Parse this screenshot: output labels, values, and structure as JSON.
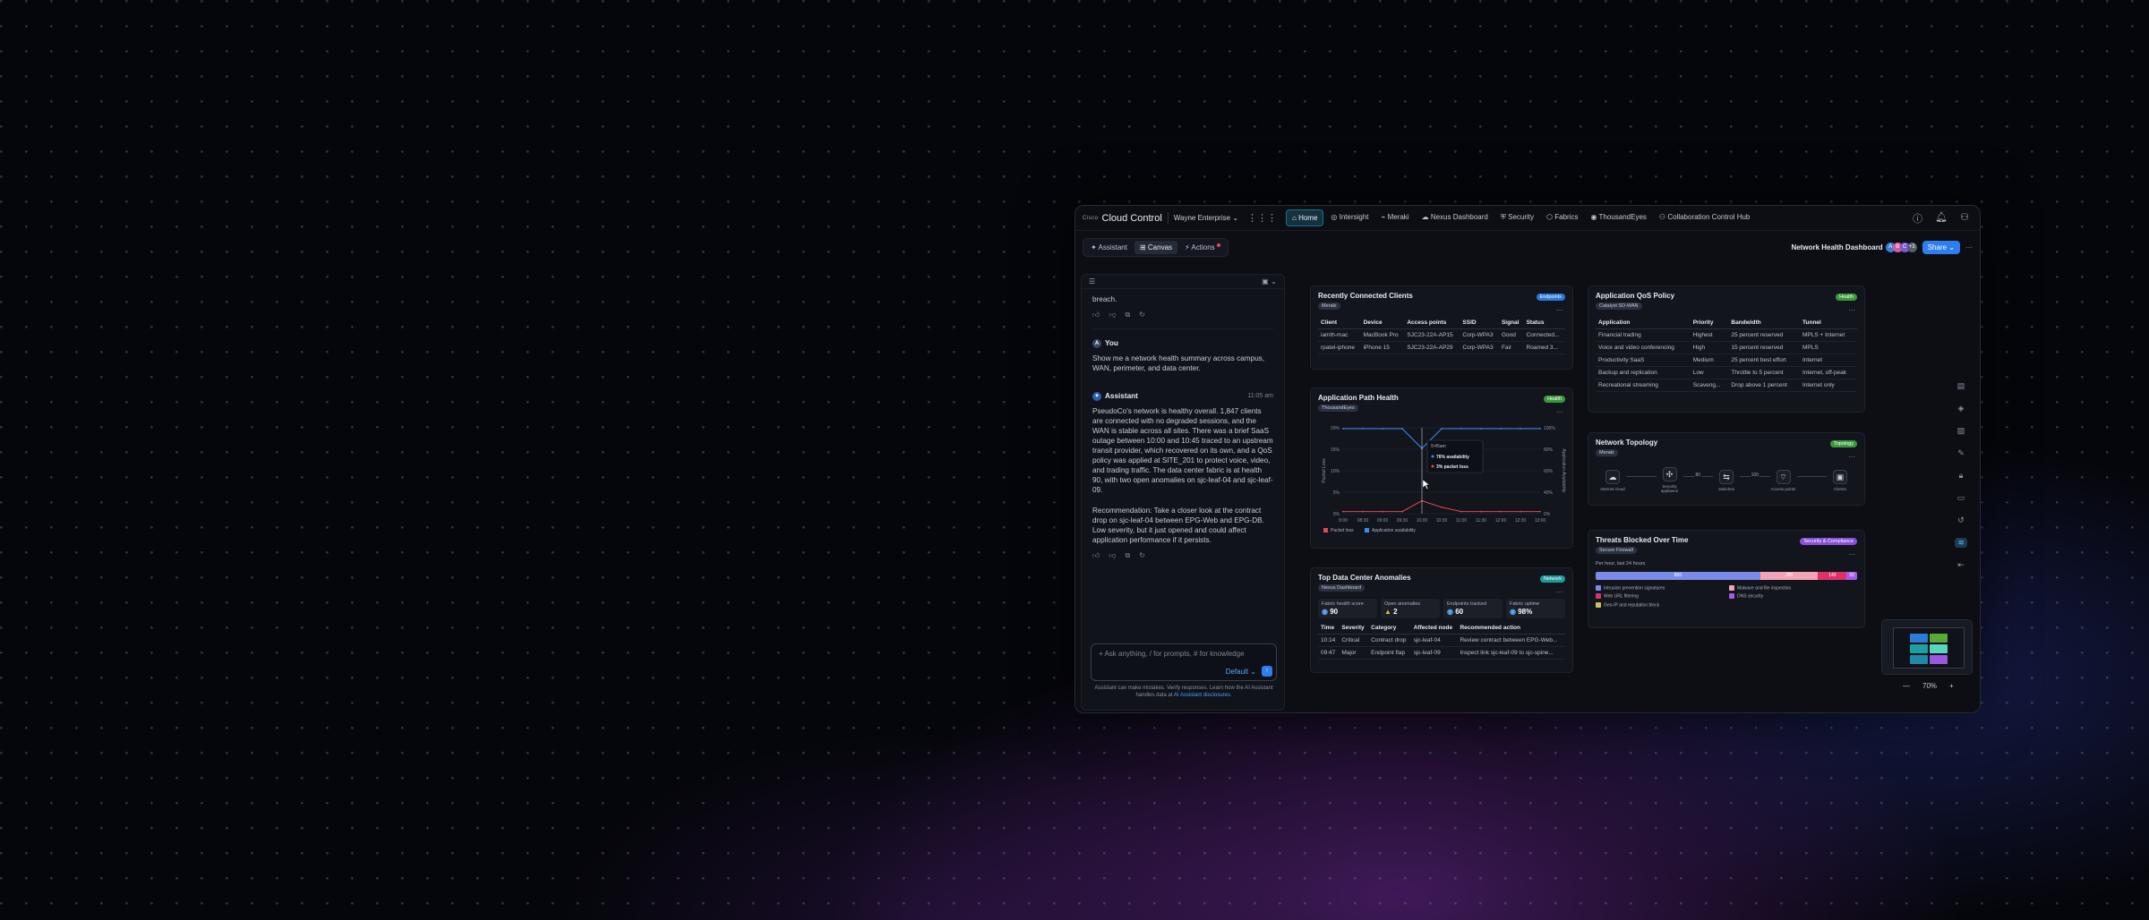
{
  "app": {
    "brand": "Cisco",
    "title": "Cloud Control",
    "org": "Wayne Enterprise"
  },
  "nav": {
    "tabs": [
      "Home",
      "Intersight",
      "Meraki",
      "Nexus Dashboard",
      "Security",
      "Fabrics",
      "ThousandEyes",
      "Collaboration Control Hub"
    ],
    "active": "Home"
  },
  "modes": {
    "assistant": "Assistant",
    "canvas": "Canvas",
    "actions": "Actions"
  },
  "dashboard": {
    "title": "Network Health Dashboard",
    "avatars": [
      "A",
      "B",
      "C",
      "+3"
    ],
    "share": "Share"
  },
  "chat": {
    "prev_tail": "breach.",
    "user_name": "You",
    "user_msg": "Show me a network health summary across campus, WAN, perimeter, and data center.",
    "assistant_name": "Assistant",
    "time": "11:05 am",
    "reply1": "PseudoCo's network is healthy overall. 1,847 clients are connected with no degraded sessions, and the WAN is stable across all sites. There was a brief SaaS outage between 10:00 and 10:45 traced to an upstream transit provider, which recovered on its own, and a QoS policy was applied at SITE_201 to protect voice, video, and trading traffic. The data center fabric is at health 90, with two open anomalies on sjc-leaf-04 and sjc-leaf-09.",
    "reply2": "Recommendation: Take a closer look at the contract drop on sjc-leaf-04 between EPG-Web and EPG-DB. Low severity, but it just opened and could affect application performance if it persists.",
    "placeholder": "Ask anything, / for prompts, # for knowledge",
    "model": "Default",
    "disclaimer": "Assistant can make mistakes. Verify responses. Learn how the AI Assistant handles data at",
    "disclaimer_link": "AI Assistant disclosures."
  },
  "clients": {
    "title": "Recently Connected Clients",
    "source": "Meraki",
    "tag": "Endpoints",
    "tag_color": "#2a79d8",
    "headers": [
      "Client",
      "Device",
      "Access points",
      "SSID",
      "Signal",
      "Status"
    ],
    "rows": [
      [
        "iamth-mac",
        "MacBook Pro",
        "SJC23-22A-AP15",
        "Corp-WPA3",
        "Good",
        "Connected..."
      ],
      [
        "rpatel-iphone",
        "iPhone 15",
        "SJC23-22A-AP29",
        "Corp-WPA3",
        "Fair",
        "Roamed 3..."
      ]
    ]
  },
  "qos": {
    "title": "Application QoS Policy",
    "source": "Catalyst SD-WAN",
    "tag": "Health",
    "tag_color": "#3a9a3a",
    "headers": [
      "Application",
      "Priority",
      "Bandwidth",
      "Tunnel"
    ],
    "rows": [
      [
        "Financial trading",
        "Highest",
        "25 percent reserved",
        "MPLS + Internet"
      ],
      [
        "Voice and video conferencing",
        "High",
        "15 percent reserved",
        "MPLS"
      ],
      [
        "Productivity SaaS",
        "Medium",
        "25 percent best effort",
        "Internet"
      ],
      [
        "Backup and replication",
        "Low",
        "Throttle to 5 percent",
        "Internet, off-peak"
      ],
      [
        "Recreational streaming",
        "Scaveng...",
        "Drop above 1 percent",
        "Internet only"
      ]
    ]
  },
  "path": {
    "title": "Application Path Health",
    "source": "ThousandEyes",
    "tag": "Health",
    "tag_color": "#3a9a3a",
    "left_axis": "Packet Loss",
    "right_axis": "Application Availability",
    "left_ticks": [
      "20%",
      "15%",
      "10%",
      "5%",
      "0%"
    ],
    "right_ticks": [
      "100%",
      "80%",
      "60%",
      "40%",
      "0%"
    ],
    "x_ticks": [
      "8:00",
      "08:30",
      "09:00",
      "09:30",
      "10:00",
      "10:30",
      "11:00",
      "11:30",
      "12:00",
      "12:30",
      "13:00"
    ],
    "tooltip_time": "9:45am",
    "tooltip_avail": "76% availability",
    "tooltip_loss": "3% packet loss",
    "legend": [
      "Packet loss",
      "Application availability"
    ],
    "loss_color": "#e5484d",
    "avail_color": "#3d8bf0"
  },
  "chart_data": {
    "type": "line",
    "x": [
      "8:00",
      "08:30",
      "09:00",
      "09:30",
      "10:00",
      "10:30",
      "11:00",
      "11:30",
      "12:00",
      "12:30",
      "13:00"
    ],
    "series": [
      {
        "name": "Packet loss",
        "values": [
          0.5,
          0.5,
          0.5,
          0.5,
          3,
          1.5,
          0.5,
          0.5,
          0.5,
          0.5,
          0.5
        ]
      },
      {
        "name": "Application availability",
        "values": [
          99,
          99,
          99,
          99,
          76,
          99,
          99,
          99,
          99,
          99,
          99
        ]
      }
    ],
    "ylim_left": [
      0,
      20
    ],
    "ylim_right": [
      0,
      100
    ]
  },
  "topology": {
    "title": "Network Topology",
    "source": "Meraki",
    "tag": "Topology",
    "tag_color": "#3a9a3a",
    "nodes": [
      "Internet cloud",
      "Security appliance",
      "Switches",
      "Access points",
      "Clients"
    ],
    "links": [
      "",
      "80",
      "100",
      "",
      ""
    ]
  },
  "threats": {
    "title": "Threats Blocked Over Time",
    "source": "Secure Firewall",
    "tag": "Security & Compliance",
    "tag_color": "#8a4fd8",
    "range": "Per hour, last 24 hours",
    "segments": [
      {
        "label": "800",
        "value": 800,
        "color": "#7b8be8"
      },
      {
        "label": "280",
        "value": 280,
        "color": "#f3a3b4"
      },
      {
        "label": "140",
        "value": 140,
        "color": "#e0306a"
      },
      {
        "label": "50",
        "value": 50,
        "color": "#a65ce8"
      }
    ],
    "legend": [
      {
        "label": "Intrusion prevention signatures",
        "color": "#7b8be8"
      },
      {
        "label": "Malware and file inspection",
        "color": "#f3a3b4"
      },
      {
        "label": "Web URL filtering",
        "color": "#e0306a"
      },
      {
        "label": "DNS security",
        "color": "#a65ce8"
      },
      {
        "label": "Geo-IP and reputation block",
        "color": "#c6c25a"
      }
    ]
  },
  "anomalies": {
    "title": "Top Data Center Anomalies",
    "source": "Nexus Dashboard",
    "tag": "Network",
    "tag_color": "#1e9a9a",
    "kpis": [
      {
        "label": "Fabric health score",
        "value": "90"
      },
      {
        "label": "Open anomalies",
        "value": "2"
      },
      {
        "label": "Endpoints tracked",
        "value": "60"
      },
      {
        "label": "Fabric uptime",
        "value": "98%"
      }
    ],
    "headers": [
      "Time",
      "Severity",
      "Category",
      "Affected node",
      "Recommended action"
    ],
    "rows": [
      [
        "10:14",
        "Critical",
        "Contract drop",
        "sjc-leaf-04",
        "Review contract between EPG-Web..."
      ],
      [
        "09:47",
        "Major",
        "Endpoint flap",
        "sjc-leaf-09",
        "Inspect link sjc-leaf-09 to sjc-spine..."
      ]
    ]
  },
  "zoom": "70%"
}
